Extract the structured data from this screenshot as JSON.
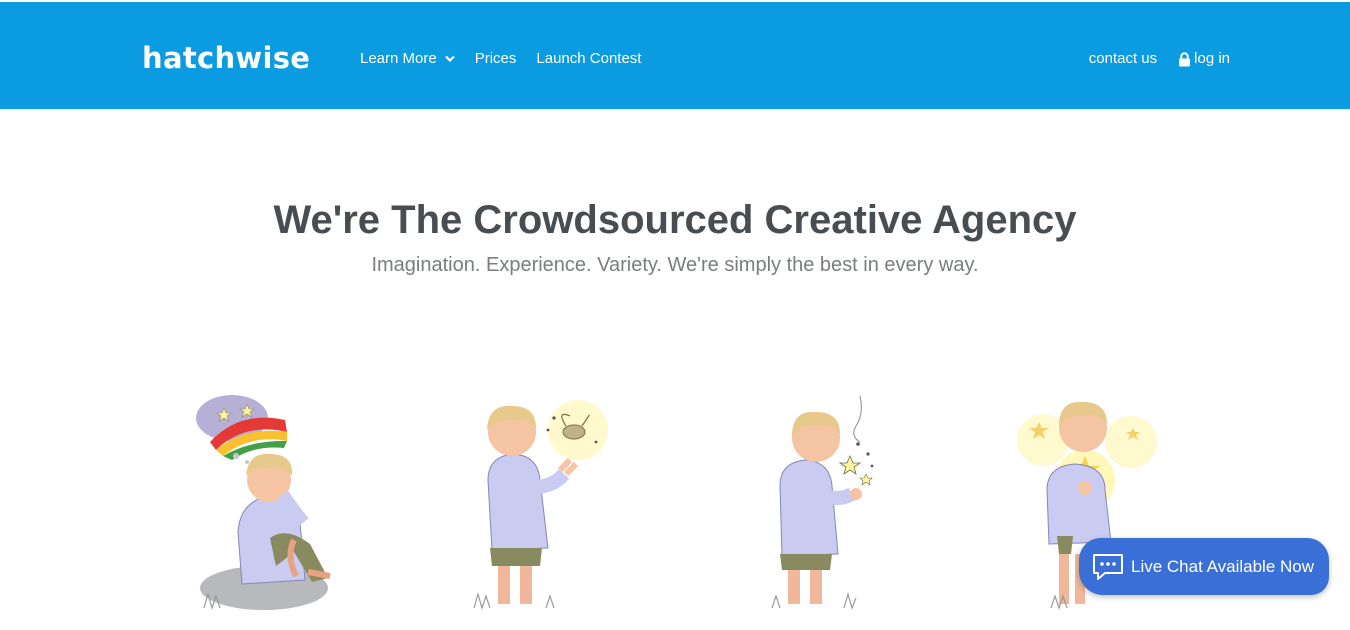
{
  "header": {
    "logo": "hatchwise",
    "nav": [
      {
        "label": "Learn More",
        "has_dropdown": true
      },
      {
        "label": "Prices"
      },
      {
        "label": "Launch Contest"
      }
    ],
    "contact_label": "contact us",
    "login_label": "log in",
    "background_color": "#0a9be0"
  },
  "hero": {
    "title": "We're The Crowdsourced Creative Agency",
    "subtitle": "Imagination. Experience. Variety. We're simply the best in every way."
  },
  "illustrations": [
    {
      "icon": "boy-dreaming-rainbow-cloud-illustration"
    },
    {
      "icon": "boy-with-firefly-illustration"
    },
    {
      "icon": "boy-with-stars-illustration"
    },
    {
      "icon": "boy-holding-glowing-star-illustration"
    }
  ],
  "live_chat": {
    "label": "Live Chat Available Now",
    "icon": "chat-bubble-icon",
    "color": "#3a6fd8"
  }
}
